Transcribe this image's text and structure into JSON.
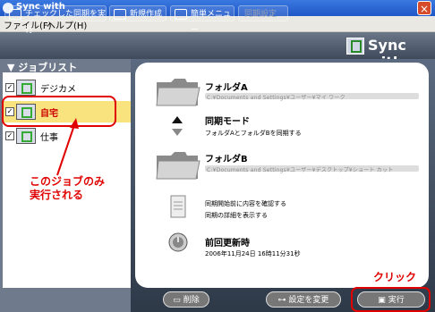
{
  "window": {
    "title": "Sync with",
    "close_glyph": "×"
  },
  "menu": {
    "items": [
      "ファイル(F)",
      "ヘルプ(H)"
    ]
  },
  "toolbar": {
    "buttons": [
      "チェックした同期を実行",
      "新規作成",
      "簡単メニュー",
      "同期設定"
    ],
    "brand": "Sync with"
  },
  "job_list": {
    "header": "▼ ジョブリスト",
    "items": [
      {
        "label": "デジカメ",
        "checked": true
      },
      {
        "label": "自宅",
        "checked": true,
        "selected": true
      },
      {
        "label": "仕事",
        "checked": true
      }
    ]
  },
  "annotation": {
    "line1": "このジョブのみ",
    "line2": "実行される",
    "click": "クリック"
  },
  "details": {
    "folder_a": {
      "title": "フォルダA",
      "path": "C:¥Documents and Settings¥ユーザー¥マイ ワーク"
    },
    "mode": {
      "title": "同期モード",
      "desc": "フォルダAとフォルダBを同期する"
    },
    "folder_b": {
      "title": "フォルダB",
      "path": "C:¥Documents and Settings¥ユーザー¥デスクトップ¥ショート カット"
    },
    "options": {
      "line1": "同期開始前に内容を確認する",
      "line2": "同期の詳細を表示する"
    },
    "last_update": {
      "title": "前回更新時",
      "value": "2006年11月24日 16時11分31秒"
    }
  },
  "footer": {
    "delete": "削除",
    "settings": "設定を変更",
    "run": "実行"
  },
  "colors": {
    "accent": "#e00000",
    "selected": "#f8e37e"
  }
}
